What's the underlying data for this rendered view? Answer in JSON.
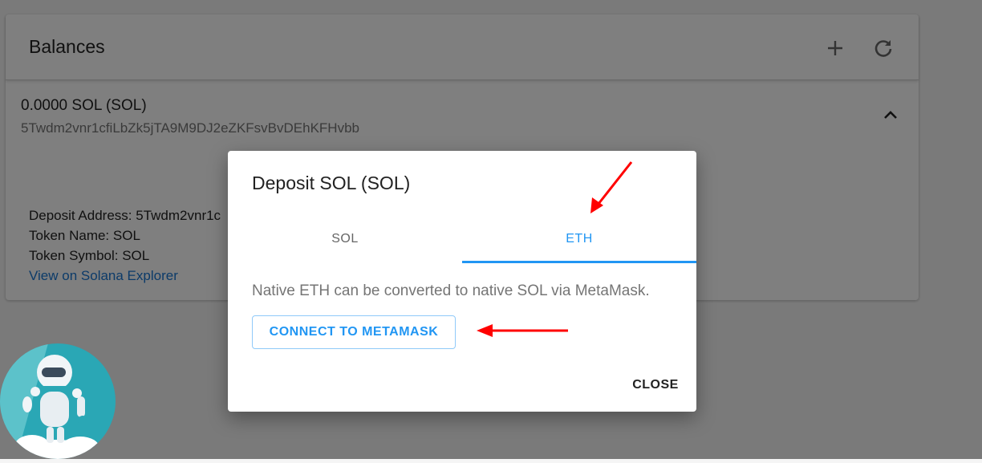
{
  "balances": {
    "title": "Balances",
    "add_icon": "plus-icon",
    "refresh_icon": "refresh-icon",
    "account": {
      "amount": "0.0000 SOL (SOL)",
      "address": "5Twdm2vnr1cfiLbZk5jTA9M9DJ2eZKFsvBvDEhKFHvbb"
    },
    "details": {
      "deposit_address": "Deposit Address: 5Twdm2vnr1c",
      "token_name": "Token Name: SOL",
      "token_symbol": "Token Symbol: SOL",
      "explorer_link": "View on Solana Explorer"
    }
  },
  "dialog": {
    "title": "Deposit SOL (SOL)",
    "tabs": [
      {
        "label": "SOL",
        "selected": false
      },
      {
        "label": "ETH",
        "selected": true
      }
    ],
    "message": "Native ETH can be converted to native SOL via MetaMask.",
    "connect_label": "CONNECT TO METAMASK",
    "close_label": "CLOSE"
  },
  "colors": {
    "accent": "#2196f3",
    "annotation_arrow": "#ff0000",
    "mascot_circle": "#2aa7b5"
  }
}
